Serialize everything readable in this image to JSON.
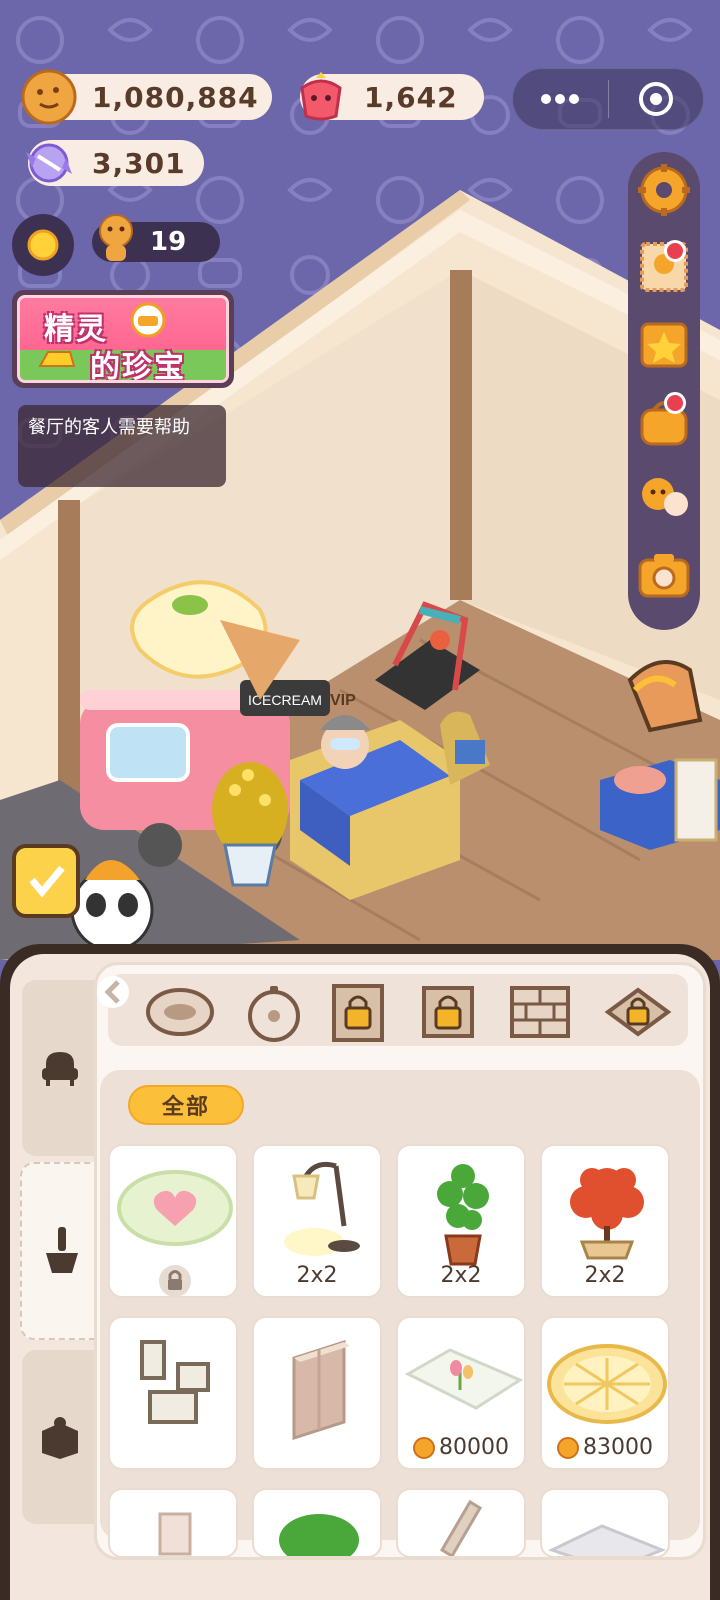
{
  "currencies": {
    "cookies": "1,080,884",
    "gems": "1,642",
    "candy": "3,301",
    "helpers": "19"
  },
  "capsule": {
    "more_icon": "more-dots-icon",
    "close_icon": "target-circle-icon"
  },
  "event": {
    "line1": "精灵",
    "line2": "的珍宝"
  },
  "task": {
    "text": "餐厅的客人需要帮助"
  },
  "sign_text": "ICECREAM",
  "vip_text": "VIP",
  "side_menu": [
    "settings-icon",
    "stamp-icon",
    "star-shop-icon",
    "bag-icon",
    "friends-icon",
    "camera-icon"
  ],
  "categories": [
    "rug-oval",
    "rug-round",
    "locked-wall",
    "locked-wall-2",
    "brick-wall",
    "locked-floor"
  ],
  "filter": {
    "all": "全部"
  },
  "items": [
    {
      "name": "heart-rug",
      "locked": true
    },
    {
      "name": "floor-lamp",
      "size": "2x2"
    },
    {
      "name": "potted-plant",
      "size": "2x2"
    },
    {
      "name": "maple-tree",
      "size": "2x2"
    },
    {
      "name": "picture-frames"
    },
    {
      "name": "wall-panel"
    },
    {
      "name": "tulip-rug",
      "price": "80000"
    },
    {
      "name": "lemon-rug",
      "price": "83000"
    }
  ],
  "colors": {
    "accent": "#fbbf3a",
    "wall": "#6c66aa",
    "panel": "#f3e6dc"
  }
}
